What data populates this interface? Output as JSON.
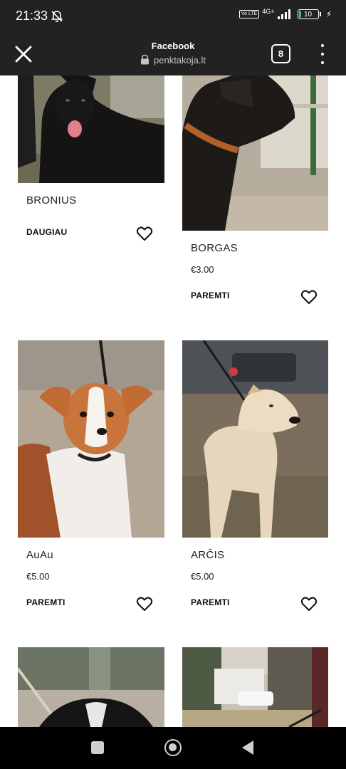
{
  "status_bar": {
    "time": "21:33",
    "network": "4G+",
    "volte": "Vo LTE",
    "battery": "10",
    "mute_icon": "bell-off-icon"
  },
  "browser": {
    "title": "Facebook",
    "url": "penktakoja.lt",
    "tab_count": "8"
  },
  "cards": [
    {
      "name": "BRONIUS",
      "price": "",
      "action": "DAUGIAU"
    },
    {
      "name": "BORGAS",
      "price": "€3.00",
      "action": "PAREMTI"
    },
    {
      "name": "AuAu",
      "price": "€5.00",
      "action": "PAREMTI"
    },
    {
      "name": "ARČIS",
      "price": "€5.00",
      "action": "PAREMTI"
    }
  ],
  "colors": {
    "bar_background": "#222222",
    "battery_fill": "#38c172"
  }
}
